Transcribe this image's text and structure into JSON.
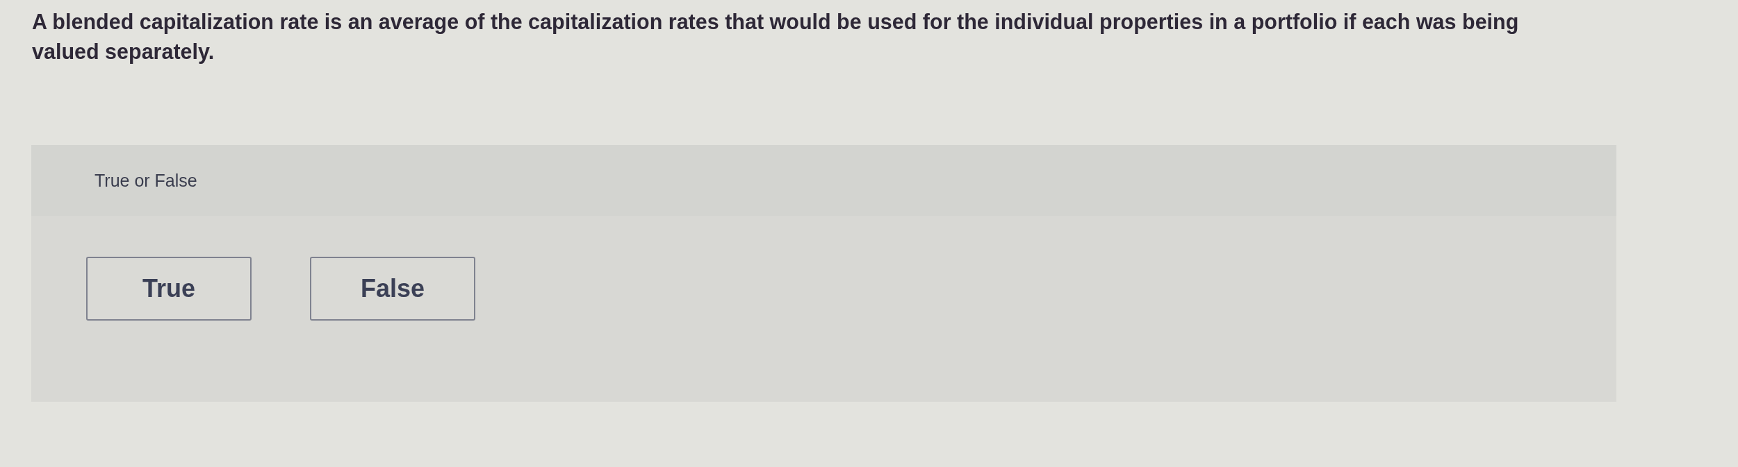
{
  "question": {
    "text": "A blended capitalization rate is an average of the capitalization rates that would be used for the individual properties in a portfolio if each was being valued separately."
  },
  "answer_panel": {
    "prompt": "True or False",
    "options": [
      {
        "label": "True",
        "selected": false
      },
      {
        "label": "False",
        "selected": false
      }
    ]
  }
}
